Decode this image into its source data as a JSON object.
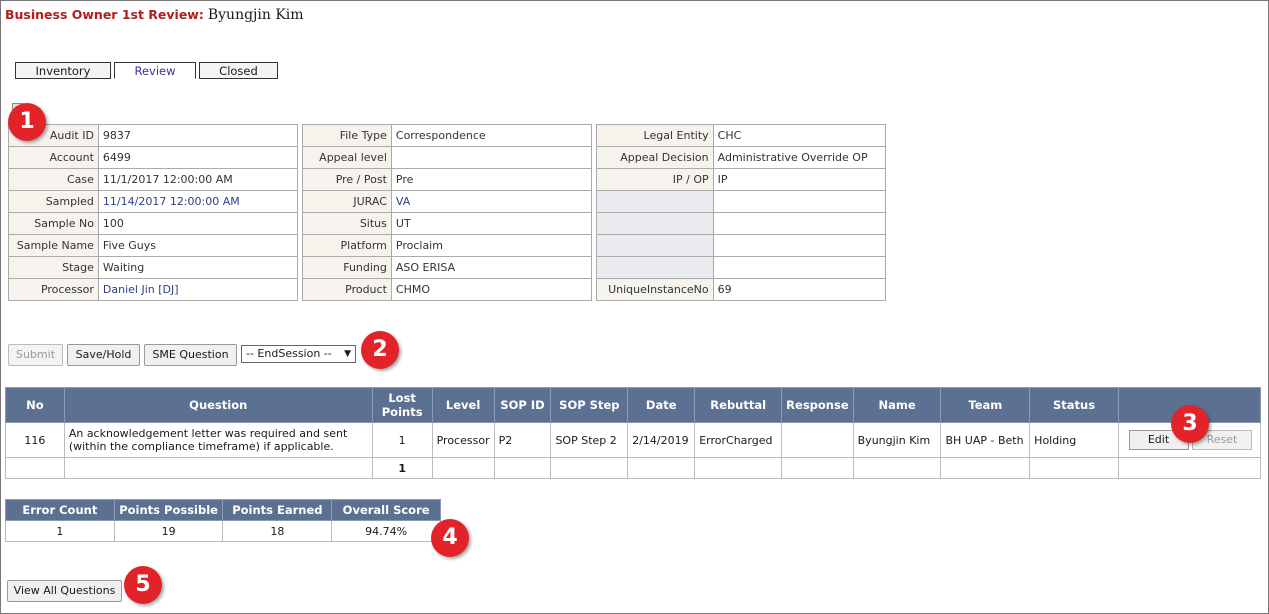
{
  "header": {
    "title_label": "Business Owner 1st Review:",
    "title_name": "Byungjin Kim"
  },
  "tabs": [
    {
      "label": "Inventory"
    },
    {
      "label": "Review"
    },
    {
      "label": "Closed"
    }
  ],
  "info_table_1": [
    {
      "label": "Audit ID",
      "value": "9837"
    },
    {
      "label": "Account",
      "value": "6499"
    },
    {
      "label": "Case",
      "value": "11/1/2017 12:00:00 AM"
    },
    {
      "label": "Sampled",
      "value": "11/14/2017 12:00:00 AM"
    },
    {
      "label": "Sample No",
      "value": "100"
    },
    {
      "label": "Sample Name",
      "value": "Five Guys"
    },
    {
      "label": "Stage",
      "value": "Waiting"
    },
    {
      "label": "Processor",
      "value": "Daniel Jin [DJ]"
    }
  ],
  "info_table_2": [
    {
      "label": "File Type",
      "value": "Correspondence"
    },
    {
      "label": "Appeal level",
      "value": ""
    },
    {
      "label": "Pre / Post",
      "value": "Pre"
    },
    {
      "label": "JURAC",
      "value": "VA"
    },
    {
      "label": "Situs",
      "value": "UT"
    },
    {
      "label": "Platform",
      "value": "Proclaim"
    },
    {
      "label": "Funding",
      "value": "ASO ERISA"
    },
    {
      "label": "Product",
      "value": "CHMO"
    }
  ],
  "info_table_3": [
    {
      "label": "Legal Entity",
      "value": "CHC"
    },
    {
      "label": "Appeal Decision",
      "value": "Administrative Override OP"
    },
    {
      "label": "IP / OP",
      "value": "IP"
    },
    {
      "label": "",
      "value": ""
    },
    {
      "label": "",
      "value": ""
    },
    {
      "label": "",
      "value": ""
    },
    {
      "label": "",
      "value": ""
    },
    {
      "label": "UniqueInstanceNo",
      "value": "69"
    }
  ],
  "actions": {
    "submit": "Submit",
    "save_hold": "Save/Hold",
    "sme_question": "SME Question",
    "session_select": "-- EndSession --"
  },
  "questions_table": {
    "headers": [
      "No",
      "Question",
      "Lost Points",
      "Level",
      "SOP ID",
      "SOP Step",
      "Date",
      "Rebuttal",
      "Response",
      "Name",
      "Team",
      "Status",
      ""
    ],
    "rows": [
      {
        "no": "116",
        "question": "An acknowledgement letter was required and sent (within the compliance timeframe) if applicable.",
        "lost_points": "1",
        "level": "Processor",
        "sop_id": "P2",
        "sop_step": "SOP Step 2",
        "date": "2/14/2019",
        "rebuttal": "ErrorCharged",
        "response": "",
        "name": "Byungjin Kim",
        "team": "BH UAP - Beth",
        "status": "Holding",
        "edit": "Edit",
        "reset": "Reset"
      }
    ],
    "total_lost_points": "1"
  },
  "score_table": {
    "headers": [
      "Error Count",
      "Points Possible",
      "Points Earned",
      "Overall Score"
    ],
    "values": [
      "1",
      "19",
      "18",
      "94.74%"
    ]
  },
  "view_all_button": "View All Questions",
  "markers": [
    "1",
    "2",
    "3",
    "4",
    "5"
  ],
  "colors": {
    "header_bg": "#5c7192",
    "title_red": "#b01e1e",
    "marker_red": "#e3232a",
    "label_bg": "#f5f3ec"
  }
}
